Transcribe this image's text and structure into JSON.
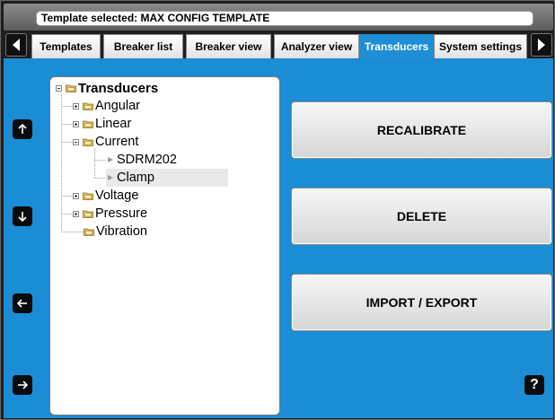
{
  "template_bar": {
    "text": "Template selected: MAX CONFIG TEMPLATE"
  },
  "tabs": [
    {
      "label": "Templates"
    },
    {
      "label": "Breaker list"
    },
    {
      "label": "Breaker view"
    },
    {
      "label": "Analyzer view"
    },
    {
      "label": "Transducers"
    },
    {
      "label": "System settings"
    }
  ],
  "active_tab": "Transducers",
  "side_buttons": {
    "up": "arrow-up-icon",
    "down": "arrow-down-icon",
    "left": "arrow-left-icon",
    "right": "arrow-right-icon"
  },
  "help": {
    "label": "?"
  },
  "tree": {
    "root": {
      "label": "Transducers"
    },
    "nodes": [
      {
        "label": "Angular"
      },
      {
        "label": "Linear"
      },
      {
        "label": "Current"
      },
      {
        "label": "SDRM202"
      },
      {
        "label": "Clamp"
      },
      {
        "label": "Voltage"
      },
      {
        "label": "Pressure"
      },
      {
        "label": "Vibration"
      }
    ],
    "selected": "Clamp"
  },
  "actions": {
    "recalibrate": "RECALIBRATE",
    "delete": "DELETE",
    "import_export": "IMPORT / EXPORT"
  },
  "colors": {
    "main_background": "#1a8dd5",
    "active_tab": "#1e8fd6",
    "frame": "#1e1e1e"
  }
}
